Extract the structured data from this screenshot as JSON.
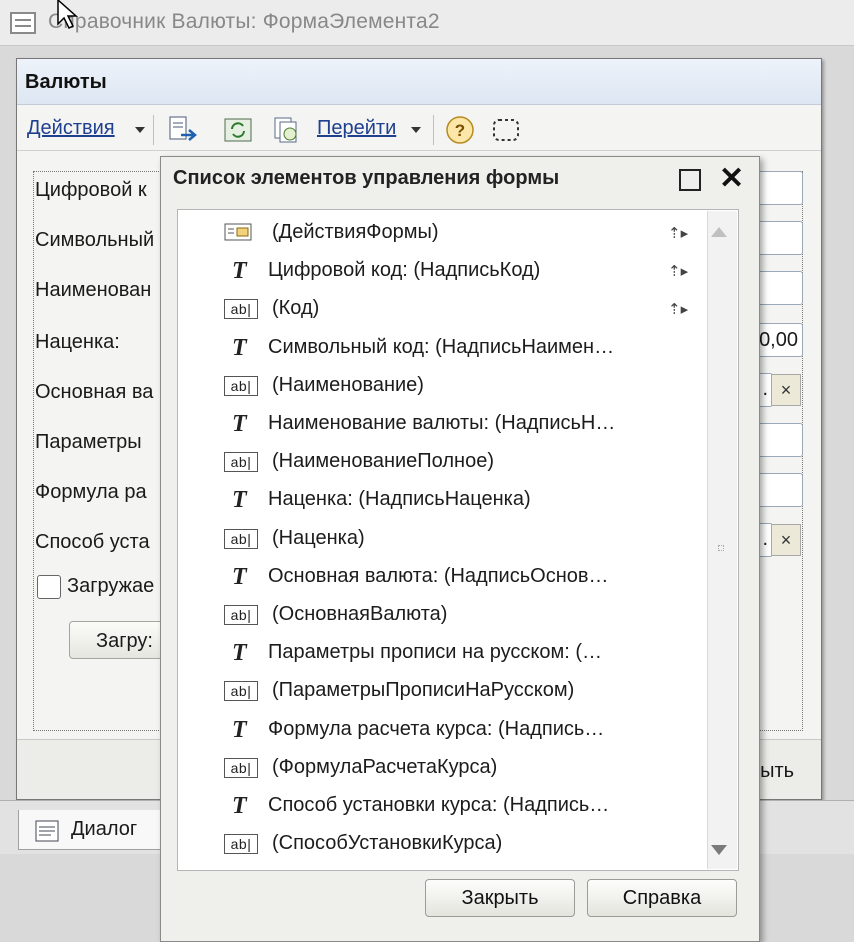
{
  "outer_window": {
    "title": "Справочник Валюты: ФормаЭлемента2"
  },
  "form": {
    "title": "Валюты",
    "toolbar": {
      "actions_label": "Действия",
      "goto_label": "Перейти"
    },
    "fields": [
      {
        "label": "Цифровой к"
      },
      {
        "label": "Символьный"
      },
      {
        "label": "Наименован"
      },
      {
        "label": "Наценка:",
        "value": "0,00"
      },
      {
        "label": "Основная ва"
      },
      {
        "label": "Параметры"
      },
      {
        "label": "Формула ра"
      },
      {
        "label": "Способ уста"
      }
    ],
    "clear_symbol": "×",
    "ellipsis": ".",
    "checkbox_label": "Загружае",
    "load_button_label": "Загру:",
    "close_button_partial": "рыть"
  },
  "tabs": {
    "dialog_label": "Диалог"
  },
  "popup": {
    "title": "Список элементов управления формы",
    "items": [
      {
        "icon": "actions-panel-icon",
        "label": "(ДействияФормы)",
        "mark": "⇡▸"
      },
      {
        "icon": "text-label-icon",
        "label": "Цифровой код: (НадписьКод)",
        "mark": "⇡▸"
      },
      {
        "icon": "text-field-icon",
        "label": "(Код)",
        "mark": "⇡▸"
      },
      {
        "icon": "text-label-icon",
        "label": "Символьный код: (НадписьНаимен…"
      },
      {
        "icon": "text-field-icon",
        "label": "(Наименование)"
      },
      {
        "icon": "text-label-icon",
        "label": "Наименование валюты: (НадписьН…"
      },
      {
        "icon": "text-field-icon",
        "label": "(НаименованиеПолное)"
      },
      {
        "icon": "text-label-icon",
        "label": "Наценка: (НадписьНаценка)"
      },
      {
        "icon": "text-field-icon",
        "label": "(Наценка)"
      },
      {
        "icon": "text-label-icon",
        "label": "Основная валюта: (НадписьОснов…"
      },
      {
        "icon": "text-field-icon",
        "label": "(ОсновнаяВалюта)"
      },
      {
        "icon": "text-label-icon",
        "label": "Параметры прописи на русском: (…"
      },
      {
        "icon": "text-field-icon",
        "label": "(ПараметрыПрописиНаРусском)"
      },
      {
        "icon": "text-label-icon",
        "label": "Формула расчета курса: (Надпись…"
      },
      {
        "icon": "text-field-icon",
        "label": "(ФормулаРасчетаКурса)"
      },
      {
        "icon": "text-label-icon",
        "label": "Способ установки курса: (Надпись…"
      },
      {
        "icon": "text-field-icon",
        "label": "(СпособУстановкиКурса)"
      }
    ],
    "icon_text": {
      "label": "T",
      "field": "ab|"
    },
    "close_button": "Закрыть",
    "help_button": "Справка"
  }
}
